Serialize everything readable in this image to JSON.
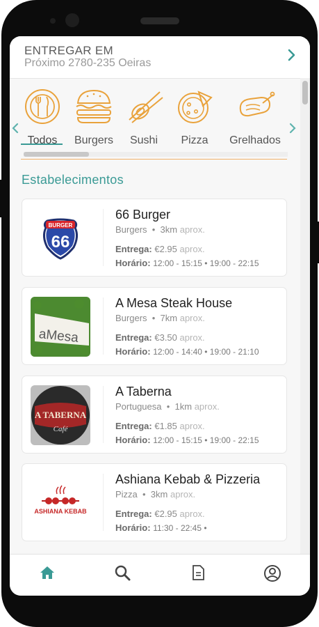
{
  "header": {
    "title": "ENTREGAR EM",
    "address": "Próximo 2780-235 Oeiras"
  },
  "categories": [
    {
      "label": "Todos",
      "icon": "cutlery-icon"
    },
    {
      "label": "Burgers",
      "icon": "burger-icon"
    },
    {
      "label": "Sushi",
      "icon": "sushi-icon"
    },
    {
      "label": "Pizza",
      "icon": "pizza-icon"
    },
    {
      "label": "Grelhados",
      "icon": "steak-icon"
    }
  ],
  "section_title": "Estabelecimentos",
  "establishments": [
    {
      "name": "66 Burger",
      "category": "Burgers",
      "distance": "3km",
      "distance_note": "aprox.",
      "delivery_label": "Entrega:",
      "delivery_fee": "€2.95",
      "delivery_note": "aprox.",
      "hours_label": "Horário:",
      "hours": "12:00 - 15:15 • 19:00 - 22:15",
      "logo": {
        "shield_text": "BURGER",
        "number": "66"
      }
    },
    {
      "name": "A Mesa Steak House",
      "category": "Burgers",
      "distance": "7km",
      "distance_note": "aprox.",
      "delivery_label": "Entrega:",
      "delivery_fee": "€3.50",
      "delivery_note": "aprox.",
      "hours_label": "Horário:",
      "hours": "12:00 - 14:40 • 19:00 - 21:10",
      "logo": {
        "text": "aMesa"
      }
    },
    {
      "name": "A Taberna",
      "category": "Portuguesa",
      "distance": "1km",
      "distance_note": "aprox.",
      "delivery_label": "Entrega:",
      "delivery_fee": "€1.85",
      "delivery_note": "aprox.",
      "hours_label": "Horário:",
      "hours": "12:00 - 15:15 • 19:00 - 22:15",
      "logo": {
        "line1": "A TABERNA",
        "line2": "Café"
      }
    },
    {
      "name": "Ashiana Kebab & Pizzeria",
      "category": "Pizza",
      "distance": "3km",
      "distance_note": "aprox.",
      "delivery_label": "Entrega:",
      "delivery_fee": "€2.95",
      "delivery_note": "aprox.",
      "hours_label": "Horário:",
      "hours": "11:30 - 22:45 •",
      "logo": {
        "text": "ASHIANA KEBAB"
      }
    }
  ],
  "nav": [
    "home-icon",
    "search-icon",
    "orders-icon",
    "account-icon"
  ],
  "colors": {
    "accent": "#3a9a95",
    "icon_orange": "#e9a23b",
    "divider_orange": "#f0b26a"
  }
}
